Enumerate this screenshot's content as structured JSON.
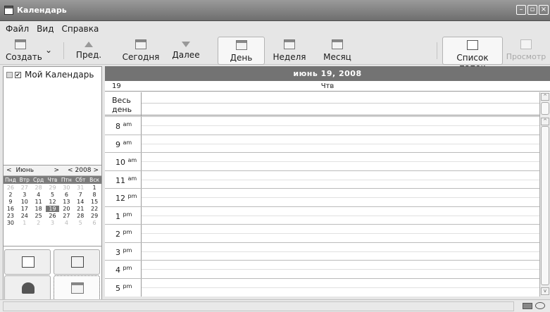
{
  "window": {
    "title": "Календарь"
  },
  "menu": [
    "Файл",
    "Вид",
    "Справка"
  ],
  "toolbar": {
    "create": "Создать",
    "prev": "Пред.",
    "today": "Сегодня",
    "next": "Далее",
    "day": "День",
    "week": "Неделя",
    "month": "Месяц",
    "folders": "Список папок",
    "preview": "Просмотр"
  },
  "calendars": [
    {
      "label": "Мой Календарь",
      "checked": true
    }
  ],
  "mini_calendar": {
    "month": "Июнь",
    "year": "2008",
    "weekdays": [
      "Пнд",
      "Втр",
      "Срд",
      "Чтв",
      "Птн",
      "Сбт",
      "Вск"
    ],
    "weeks": [
      [
        "26",
        "27",
        "28",
        "29",
        "30",
        "31",
        "1"
      ],
      [
        "2",
        "3",
        "4",
        "5",
        "6",
        "7",
        "8"
      ],
      [
        "9",
        "10",
        "11",
        "12",
        "13",
        "14",
        "15"
      ],
      [
        "16",
        "17",
        "18",
        "19",
        "20",
        "21",
        "22"
      ],
      [
        "23",
        "24",
        "25",
        "26",
        "27",
        "28",
        "29"
      ],
      [
        "30",
        "1",
        "2",
        "3",
        "4",
        "5",
        "6"
      ]
    ],
    "selected": "19"
  },
  "day_view": {
    "header": "июнь  19,  2008",
    "day_number": "19",
    "weekday": "Чтв",
    "all_day_line1": "Весь",
    "all_day_line2": "день",
    "hours": [
      {
        "h": "8",
        "ap": "am"
      },
      {
        "h": "9",
        "ap": "am"
      },
      {
        "h": "10",
        "ap": "am"
      },
      {
        "h": "11",
        "ap": "am"
      },
      {
        "h": "12",
        "ap": "pm"
      },
      {
        "h": "1",
        "ap": "pm"
      },
      {
        "h": "2",
        "ap": "pm"
      },
      {
        "h": "3",
        "ap": "pm"
      },
      {
        "h": "4",
        "ap": "pm"
      },
      {
        "h": "5",
        "ap": "pm"
      }
    ]
  },
  "icons": {
    "app": "calendar-app-icon",
    "views": [
      "mail-icon",
      "news-icon",
      "contacts-icon",
      "calendar-icon"
    ]
  }
}
